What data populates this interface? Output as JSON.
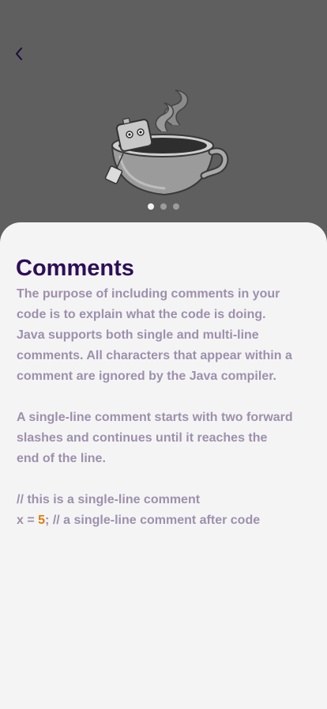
{
  "nav": {
    "back_icon": "chevron-left-icon"
  },
  "hero": {
    "illustration": "coffee-cup-icon"
  },
  "pager": {
    "total": 3,
    "active_index": 0
  },
  "lesson": {
    "title": "Comments",
    "paragraph1": "The purpose of including comments in your code is to explain what the code is doing. Java supports both single and multi-line comments. All characters that appear within a comment are ignored by the Java compiler.",
    "paragraph2": "A single-line comment starts with two forward slashes and continues until it reaches the end of the line.",
    "code": {
      "line1": "// this is a single-line comment",
      "line2_prefix": "x = ",
      "line2_number": "5",
      "line2_suffix": "; // a single-line comment after code"
    }
  },
  "colors": {
    "title": "#2d0e57",
    "body_text": "#9d90ad",
    "number_highlight": "#e07b0b",
    "card_background": "#f4f4f4",
    "overlay_background": "#5f5f5f"
  }
}
